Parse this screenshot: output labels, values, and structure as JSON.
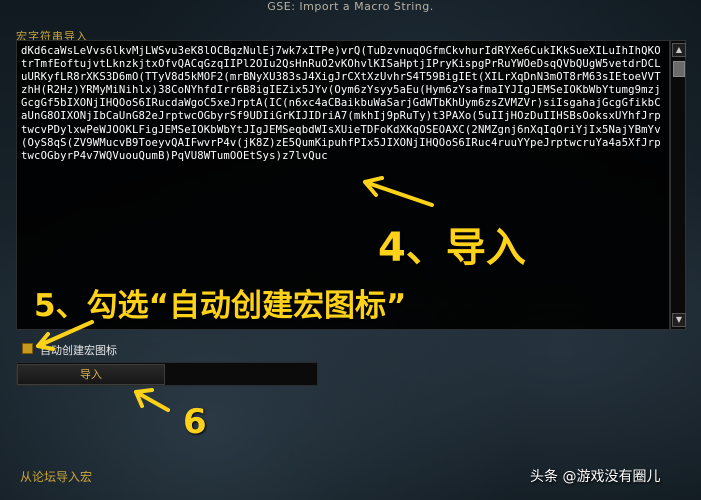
{
  "window": {
    "title": "GSE: Import a Macro String."
  },
  "section": {
    "label": "宏字符串导入"
  },
  "macro_text": "dKd6caWsLeVvs6lkvMjLWSvu3eK8lOCBqzNulEj7wk7xITPe)vrQ(TuDzvnuqOGfmCkvhurIdRYXe6CukIKkSueXILuIhIhQKOtrTmfEoftujvtLknzkjtxOfvQACqGzqIIPl2OIu2QsHnRuO2vKOhvlKISaHptjIPryKispgPrRuYWOeDsqQVbQUgW5vetdrDCLuURKyfLR8rXKS3D6mO(TTyV8d5kMOF2(mrBNyXU383sJ4XigJrCXtXzUvhrS4T59BigIEt(XILrXqDnN3mOT8rM63sIEtoeVVTzhH(R2Hz)YRMyMiNihlx)38CoNYhfdIrr6B8igIEZix5JYv(Oym6zYsyy5aEu(Hym6zYsafmaIYJIgJEMSeIOKbWbYtumg9mzjGcgGf5bIXONjIHQOoS6IRucdaWgoC5xeJrptA(IC(n6xc4aCBaikbuWaSarjGdWTbKhUym6zsZVMZVr)siIsgahajGcgGfikbCaUnG8OIXONjIbCaUnG82eJrptwcOGbyrSf9UDIiGrKIJIDriA7(mkhIj9pRuTy)t3PAXo(5uIIjHOzDuIIHSBsOoksxUYhfJrptwcvPDylxwPeWJOOKLFigJEMSeIOKbWbYtJIgJEMSeqbdWIsXUieTDFoKdXKqOSEOAXC(2NMZgnj6nXqIqOriYjIx5NajYBmYv(OyS8qS(ZV9WMucvB9ToeyvQAIFwvrP4v(jK8Z)zE5QumKipuhfPIx5JIXONjIHQOoS6IRuc4ruuYYpeJrptwcruYa4a5XfJrptwcOGbyrP4v7WQVuouQumB)PqVU8WTumOOEtSys)z7lvQuc",
  "scrollbar": {
    "up_icon": "▲",
    "down_icon": "▼"
  },
  "checkbox": {
    "label": "自动创建宏图标",
    "checked": true
  },
  "import_button": {
    "label": "导入"
  },
  "forum_link": {
    "label": "从论坛导入宏"
  },
  "annotations": {
    "step4": "4、导入",
    "step5": "5、勾选“自动创建宏图标”",
    "step6": "6",
    "color": "#ffd21a"
  },
  "watermark": {
    "text": "头条 @游戏没有圈儿"
  }
}
